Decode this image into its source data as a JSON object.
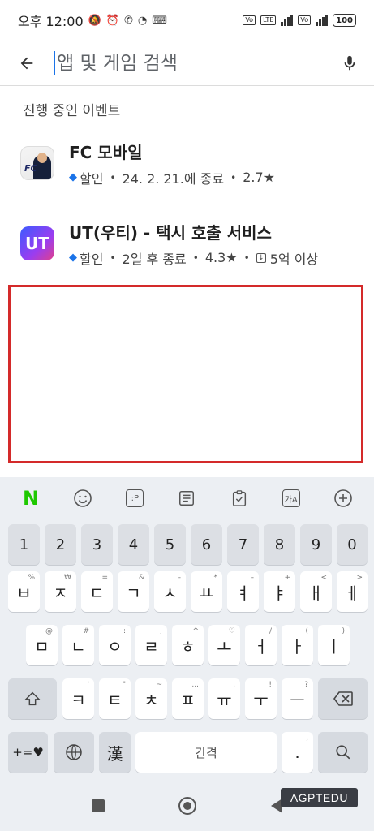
{
  "status_bar": {
    "time": "오후 12:00",
    "lte_label": "LTE",
    "battery": "100"
  },
  "search": {
    "placeholder": "앱 및 게임 검색",
    "value": ""
  },
  "events": {
    "heading": "진행 중인 이벤트",
    "items": [
      {
        "title": "FC 모바일",
        "tag": "할인",
        "end": "24. 2. 21.에 종료",
        "rating": "2.7★",
        "downloads": ""
      },
      {
        "title": "UT(우티) - 택시 호출 서비스",
        "tag": "할인",
        "end": "2일 후 종료",
        "rating": "4.3★",
        "downloads": "5억 이상"
      }
    ]
  },
  "keyboard": {
    "toolbar": [
      "naver-n",
      "emoji",
      "sticker",
      "memo",
      "clipboard",
      "translate",
      "add"
    ],
    "n_label": "N",
    "sticker_label": ":P",
    "translate_label": "가A",
    "numbers": [
      "1",
      "2",
      "3",
      "4",
      "5",
      "6",
      "7",
      "8",
      "9",
      "0"
    ],
    "row1": [
      {
        "k": "ㅂ",
        "s": "%"
      },
      {
        "k": "ㅈ",
        "s": "₩"
      },
      {
        "k": "ㄷ",
        "s": "="
      },
      {
        "k": "ㄱ",
        "s": "&"
      },
      {
        "k": "ㅅ",
        "s": "-"
      },
      {
        "k": "ㅛ",
        "s": "*"
      },
      {
        "k": "ㅕ",
        "s": "-"
      },
      {
        "k": "ㅑ",
        "s": "+"
      },
      {
        "k": "ㅐ",
        "s": "<"
      },
      {
        "k": "ㅔ",
        "s": ">"
      }
    ],
    "row2": [
      {
        "k": "ㅁ",
        "s": "@"
      },
      {
        "k": "ㄴ",
        "s": "#"
      },
      {
        "k": "ㅇ",
        "s": ":"
      },
      {
        "k": "ㄹ",
        "s": ";"
      },
      {
        "k": "ㅎ",
        "s": "^"
      },
      {
        "k": "ㅗ",
        "s": "♡"
      },
      {
        "k": "ㅓ",
        "s": "/"
      },
      {
        "k": "ㅏ",
        "s": "("
      },
      {
        "k": "ㅣ",
        "s": ")"
      }
    ],
    "row3": [
      {
        "k": "ㅋ",
        "s": "'"
      },
      {
        "k": "ㅌ",
        "s": "\""
      },
      {
        "k": "ㅊ",
        "s": "~"
      },
      {
        "k": "ㅍ",
        "s": "..."
      },
      {
        "k": "ㅠ",
        "s": ","
      },
      {
        "k": "ㅜ",
        "s": "!"
      },
      {
        "k": "ㅡ",
        "s": "?"
      }
    ],
    "symbols_key": "+=♥",
    "hanja_key": "漢",
    "space_label": "간격",
    "period_key": ".",
    "period_sub": ","
  },
  "watermark": "AGPTEDU",
  "colors": {
    "accent": "#1a73e8",
    "highlight_box": "#d42a2a",
    "keyboard_bg": "#eceff3"
  }
}
